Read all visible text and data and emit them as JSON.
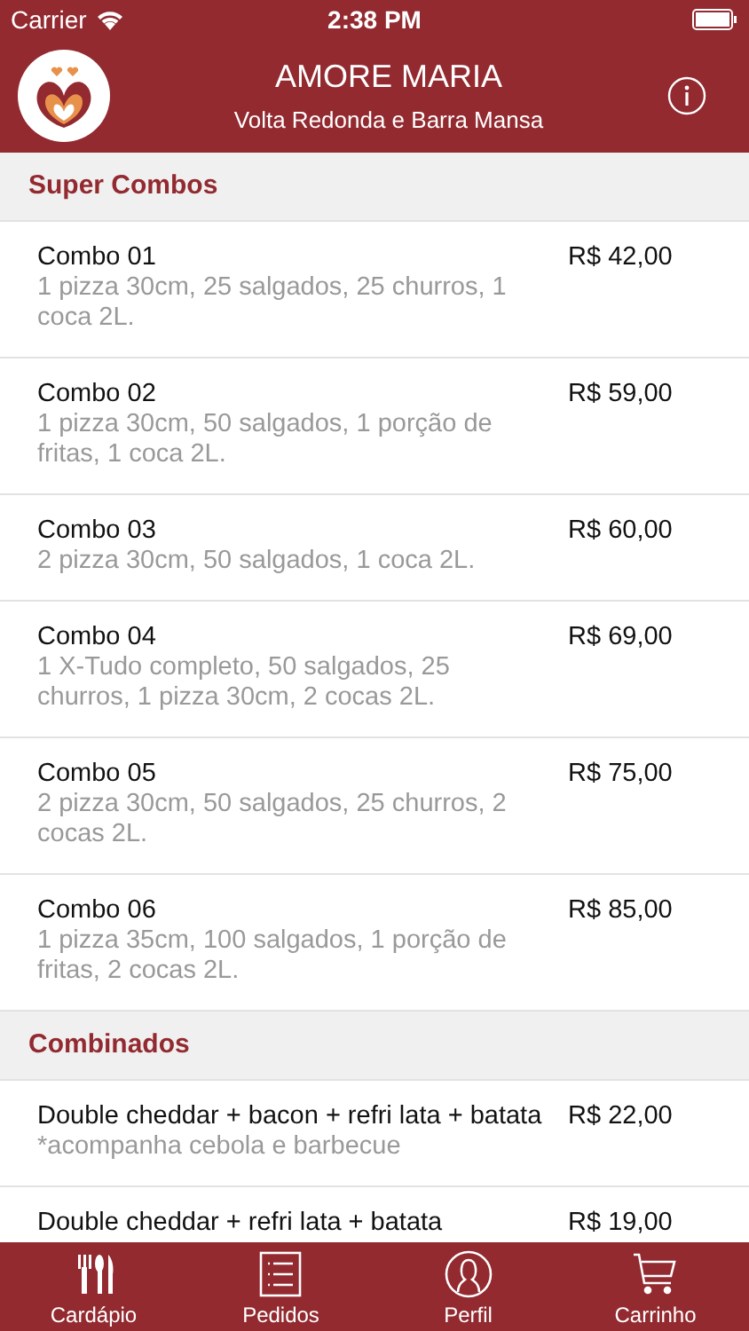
{
  "status_bar": {
    "carrier": "Carrier",
    "time": "2:38 PM"
  },
  "header": {
    "title": "AMORE MARIA",
    "subtitle": "Volta Redonda e Barra Mansa"
  },
  "sections": [
    {
      "title": "Super Combos",
      "items": [
        {
          "name": "Combo 01",
          "description": "1 pizza 30cm, 25 salgados, 25 churros, 1 coca 2L.",
          "price": "R$ 42,00"
        },
        {
          "name": "Combo 02",
          "description": "1 pizza 30cm, 50 salgados, 1 porção de fritas, 1 coca 2L.",
          "price": "R$ 59,00"
        },
        {
          "name": "Combo 03",
          "description": "2 pizza 30cm, 50 salgados, 1 coca 2L.",
          "price": "R$ 60,00"
        },
        {
          "name": "Combo 04",
          "description": "1 X-Tudo completo, 50 salgados, 25 churros, 1 pizza 30cm, 2 cocas 2L.",
          "price": "R$ 69,00"
        },
        {
          "name": "Combo 05",
          "description": "2 pizza 30cm, 50 salgados, 25 churros, 2 cocas 2L.",
          "price": "R$ 75,00"
        },
        {
          "name": "Combo 06",
          "description": "1 pizza 35cm, 100 salgados, 1 porção de fritas, 2 cocas 2L.",
          "price": "R$ 85,00"
        }
      ]
    },
    {
      "title": "Combinados",
      "items": [
        {
          "name": "Double cheddar + bacon + refri lata + batata",
          "description": "*acompanha cebola e barbecue",
          "price": "R$ 22,00"
        },
        {
          "name": "Double cheddar + refri lata + batata",
          "price": "R$ 19,00"
        }
      ]
    }
  ],
  "tabs": [
    {
      "label": "Cardápio",
      "kind": "cutlery"
    },
    {
      "label": "Pedidos",
      "kind": "list"
    },
    {
      "label": "Perfil",
      "kind": "person"
    },
    {
      "label": "Carrinho",
      "kind": "cart"
    }
  ]
}
